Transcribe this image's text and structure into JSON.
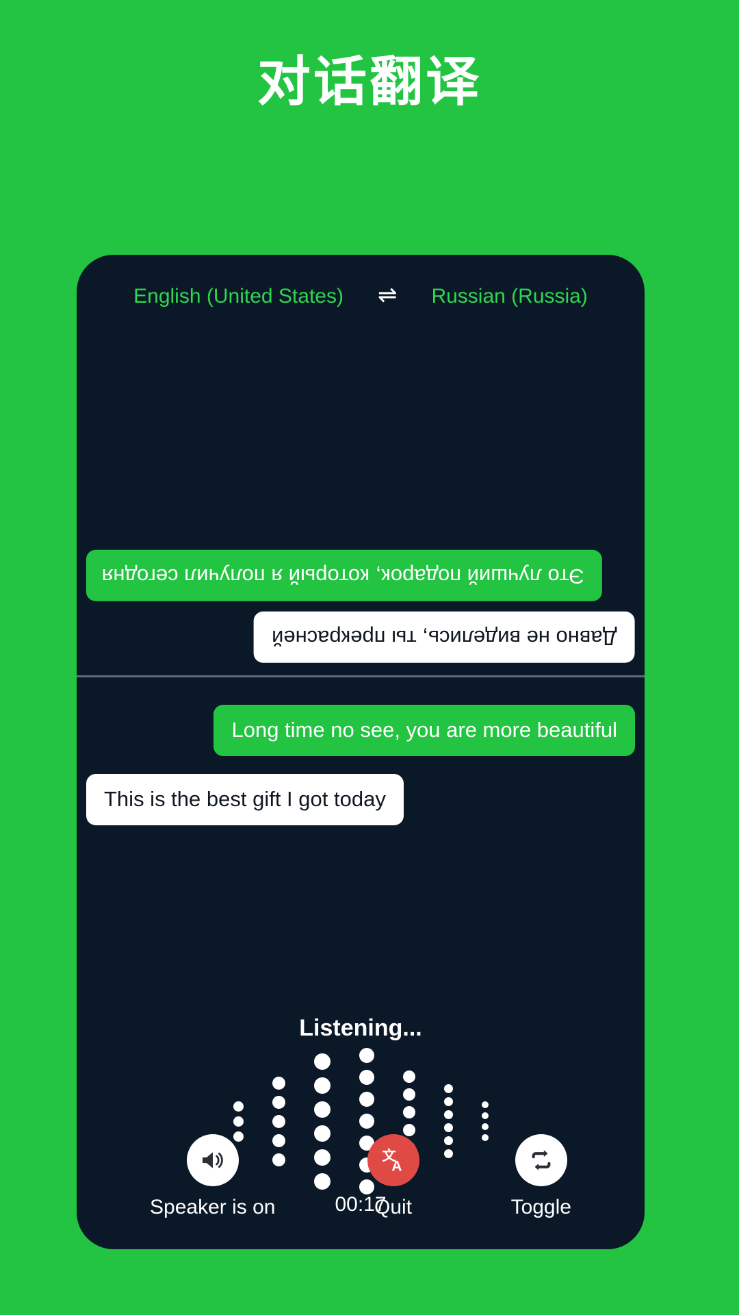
{
  "page": {
    "title": "对话翻译",
    "background_color": "#22c442",
    "card_color": "#0b1827",
    "accent_green": "#22c442",
    "language_text_color": "#2fd64f",
    "danger_color": "#e04a45"
  },
  "language_bar": {
    "source_language": "English (United States)",
    "swap_icon": "⇌",
    "target_language": "Russian (Russia)"
  },
  "remote_pane": {
    "messages": [
      {
        "text": "Это лучший подарок, который я получил сегодня",
        "style": "green",
        "align": "left",
        "rotated": true
      },
      {
        "text": "Давно не виделись, ты прекрасней",
        "style": "white",
        "align": "right",
        "rotated": true
      }
    ]
  },
  "local_pane": {
    "messages": [
      {
        "text": "Long time no see, you are more beautiful",
        "style": "green",
        "align": "right",
        "rotated": false
      },
      {
        "text": "This is the best gift I got today",
        "style": "white",
        "align": "left",
        "rotated": false
      }
    ]
  },
  "recording": {
    "status_label": "Listening...",
    "timer": "00:17",
    "waveform": {
      "columns": [
        {
          "dots": 3,
          "size": 15
        },
        {
          "dots": 5,
          "size": 19
        },
        {
          "dots": 6,
          "size": 24
        },
        {
          "dots": 7,
          "size": 22
        },
        {
          "dots": 6,
          "size": 18
        },
        {
          "dots": 6,
          "size": 13
        },
        {
          "dots": 4,
          "size": 10
        }
      ]
    }
  },
  "controls": [
    {
      "label": "Speaker is on",
      "icon": "speaker-on-icon",
      "variant": "light"
    },
    {
      "label": "Quit",
      "icon": "translate-icon",
      "variant": "danger",
      "glyph": "文"
    },
    {
      "label": "Toggle",
      "icon": "repeat-icon",
      "variant": "light"
    }
  ]
}
